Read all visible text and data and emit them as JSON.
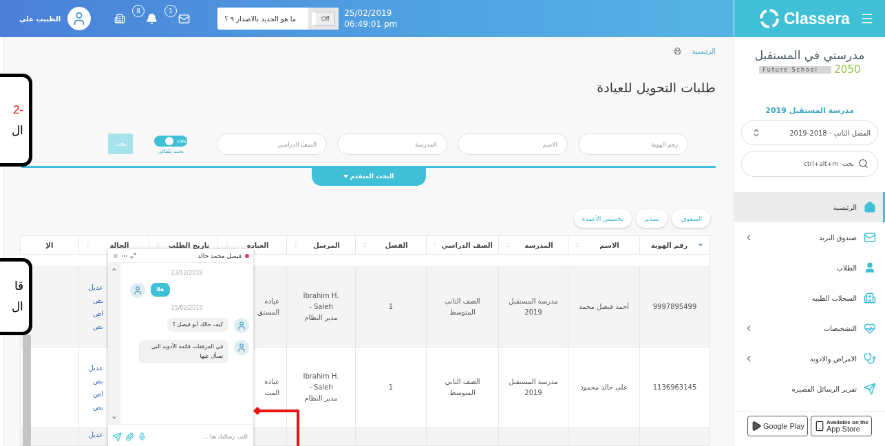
{
  "topbar": {
    "user_name": "الطبيب علي",
    "notifications": "8",
    "messages": "1",
    "whats_new": {
      "label": "ما هو الجديد بالاصدار ٩ ؟",
      "toggle": "Off",
      "on": false
    },
    "date": "25/02/2019",
    "time": "06:49:01 pm"
  },
  "breadcrumb": "الرئيسية",
  "title": "طلبات التحويل للعيادة",
  "filters": [
    {
      "placeholder": "رقم الهوية"
    },
    {
      "placeholder": "الاسم"
    },
    {
      "placeholder": "المدرسة"
    },
    {
      "placeholder": "الصف الدراسي"
    }
  ],
  "auto_search": {
    "label": "بحث تلقائي",
    "toggle": "ON",
    "on": true
  },
  "search_button": {
    "label": "بحث",
    "disabled": true
  },
  "advanced_search": "البحث المتقدم",
  "table_buttons": [
    "الصفوف",
    "تصدير",
    "تخصيص الأعمدة"
  ],
  "table": {
    "columns": [
      {
        "label": "رقم الهوية",
        "kind": "filter"
      },
      {
        "label": "الاسم",
        "kind": "sort"
      },
      {
        "label": "المدرسة",
        "kind": "sort"
      },
      {
        "label": "الصف الدراسي",
        "kind": "sort"
      },
      {
        "label": "الفصل",
        "kind": "sort"
      },
      {
        "label": "المرسل",
        "kind": "sort"
      },
      {
        "label": "العيادة",
        "kind": "sort"
      },
      {
        "label": "تاريخ الطلب",
        "kind": "sort"
      },
      {
        "label": "الحالة",
        "kind": "sort"
      },
      {
        "label": "الإ",
        "kind": "plain"
      }
    ],
    "rows": [
      {
        "id": "9997895499",
        "name": "أحمد فيصل محمد",
        "school": "مدرسة المستقبل 2019",
        "grade": "الصف الثاني المتوسط",
        "section": "1",
        "sender": "Ibrahim H. Saleh -",
        "sender_role": "مدير النظام",
        "clinic": "عيادة المستق",
        "status_links": [
          "عديل",
          "بص",
          "اض",
          "بص"
        ]
      },
      {
        "id": "1136963145",
        "name": "علي خالد محمود",
        "school": "مدرسة المستقبل 2019",
        "grade": "الصف الثاني المتوسط",
        "section": "1",
        "sender": "Ibrahim H. Saleh -",
        "sender_role": "مدير النظام",
        "clinic": "عيادة المت",
        "status_links": [
          "عديل",
          "بص",
          "اض",
          "بص"
        ]
      },
      {
        "status_links": [
          "عديل"
        ]
      }
    ]
  },
  "chat": {
    "contact": "فيصل محمد خالد",
    "online": true,
    "messages": [
      {
        "kind": "date",
        "text": "23/12/2018"
      },
      {
        "kind": "received",
        "text": "هلا"
      },
      {
        "kind": "date",
        "text": "25/02/2019"
      },
      {
        "kind": "sent",
        "text": "كيف حالك أبو فيصل ؟"
      },
      {
        "kind": "sent",
        "text": "في المرفقات قائمة الأدوية التي تسأل عنها"
      }
    ],
    "input": {
      "placeholder": "اكتب رسالتك هنا ..."
    }
  },
  "callouts": [
    {
      "lines": [
        {
          "text": "2-",
          "emphasis": true
        },
        {
          "text": "ال",
          "emphasis": false
        }
      ]
    },
    {
      "lines": [
        {
          "text": "قا",
          "emphasis": false
        },
        {
          "text": "ال",
          "emphasis": false
        }
      ]
    }
  ],
  "sidebar": {
    "brand": "Classera",
    "school_logo": {
      "arabic": "مدرستي في المستقبل",
      "english": "Future School",
      "year": "2050"
    },
    "school_name": "مدرسة المستقبل 2019",
    "term": "الفصل الثاني - 2018-2019",
    "search": {
      "placeholder": "بحث  ctrl+alt+m"
    },
    "items": [
      {
        "label": "الرئيسية",
        "kind": "home",
        "selected": true,
        "submenu": false
      },
      {
        "label": "صندوق البريد",
        "kind": "mail",
        "selected": false,
        "submenu": true
      },
      {
        "label": "الطلاب",
        "kind": "user",
        "selected": false,
        "submenu": false
      },
      {
        "label": "السجلات الطبيه",
        "kind": "hospital",
        "selected": false,
        "submenu": false
      },
      {
        "label": "التشخيصات",
        "kind": "heart",
        "selected": false,
        "submenu": true
      },
      {
        "label": "الامراض والادويه",
        "kind": "stethoscope",
        "selected": false,
        "submenu": true
      },
      {
        "label": "تقرير الرسائل القصيرة",
        "kind": "send",
        "selected": false,
        "submenu": false
      }
    ],
    "stores": [
      {
        "kind": "apple",
        "small": "Available on the",
        "label": "App Store"
      },
      {
        "kind": "google",
        "label": "Google Play"
      }
    ]
  }
}
